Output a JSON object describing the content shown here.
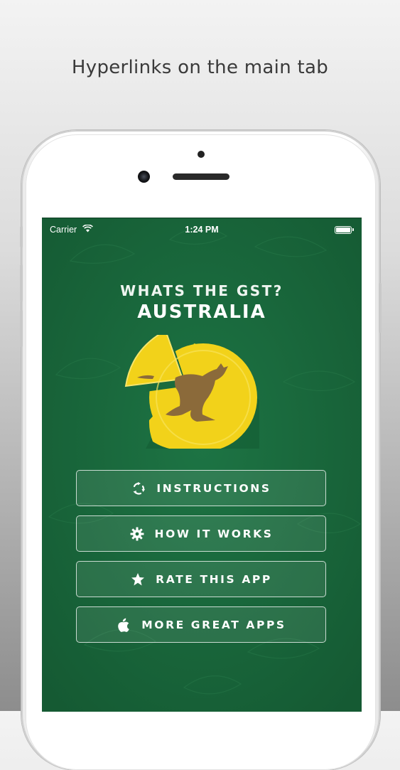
{
  "caption": "Hyperlinks on the main tab",
  "status_bar": {
    "carrier": "Carrier",
    "time": "1:24 PM"
  },
  "header": {
    "title_line1": "WHATS THE GST?",
    "title_line2": "AUSTRALIA"
  },
  "menu": [
    {
      "label": "INSTRUCTIONS",
      "icon": "recycle-arrows-icon"
    },
    {
      "label": "HOW IT WORKS",
      "icon": "gear-icon"
    },
    {
      "label": "RATE THIS APP",
      "icon": "star-icon"
    },
    {
      "label": "MORE GREAT APPS",
      "icon": "apple-icon"
    }
  ],
  "colors": {
    "screen_background": "#1a6a3d",
    "logo_yellow": "#f2d21a",
    "kangaroo_brown": "#8b6a3a"
  }
}
